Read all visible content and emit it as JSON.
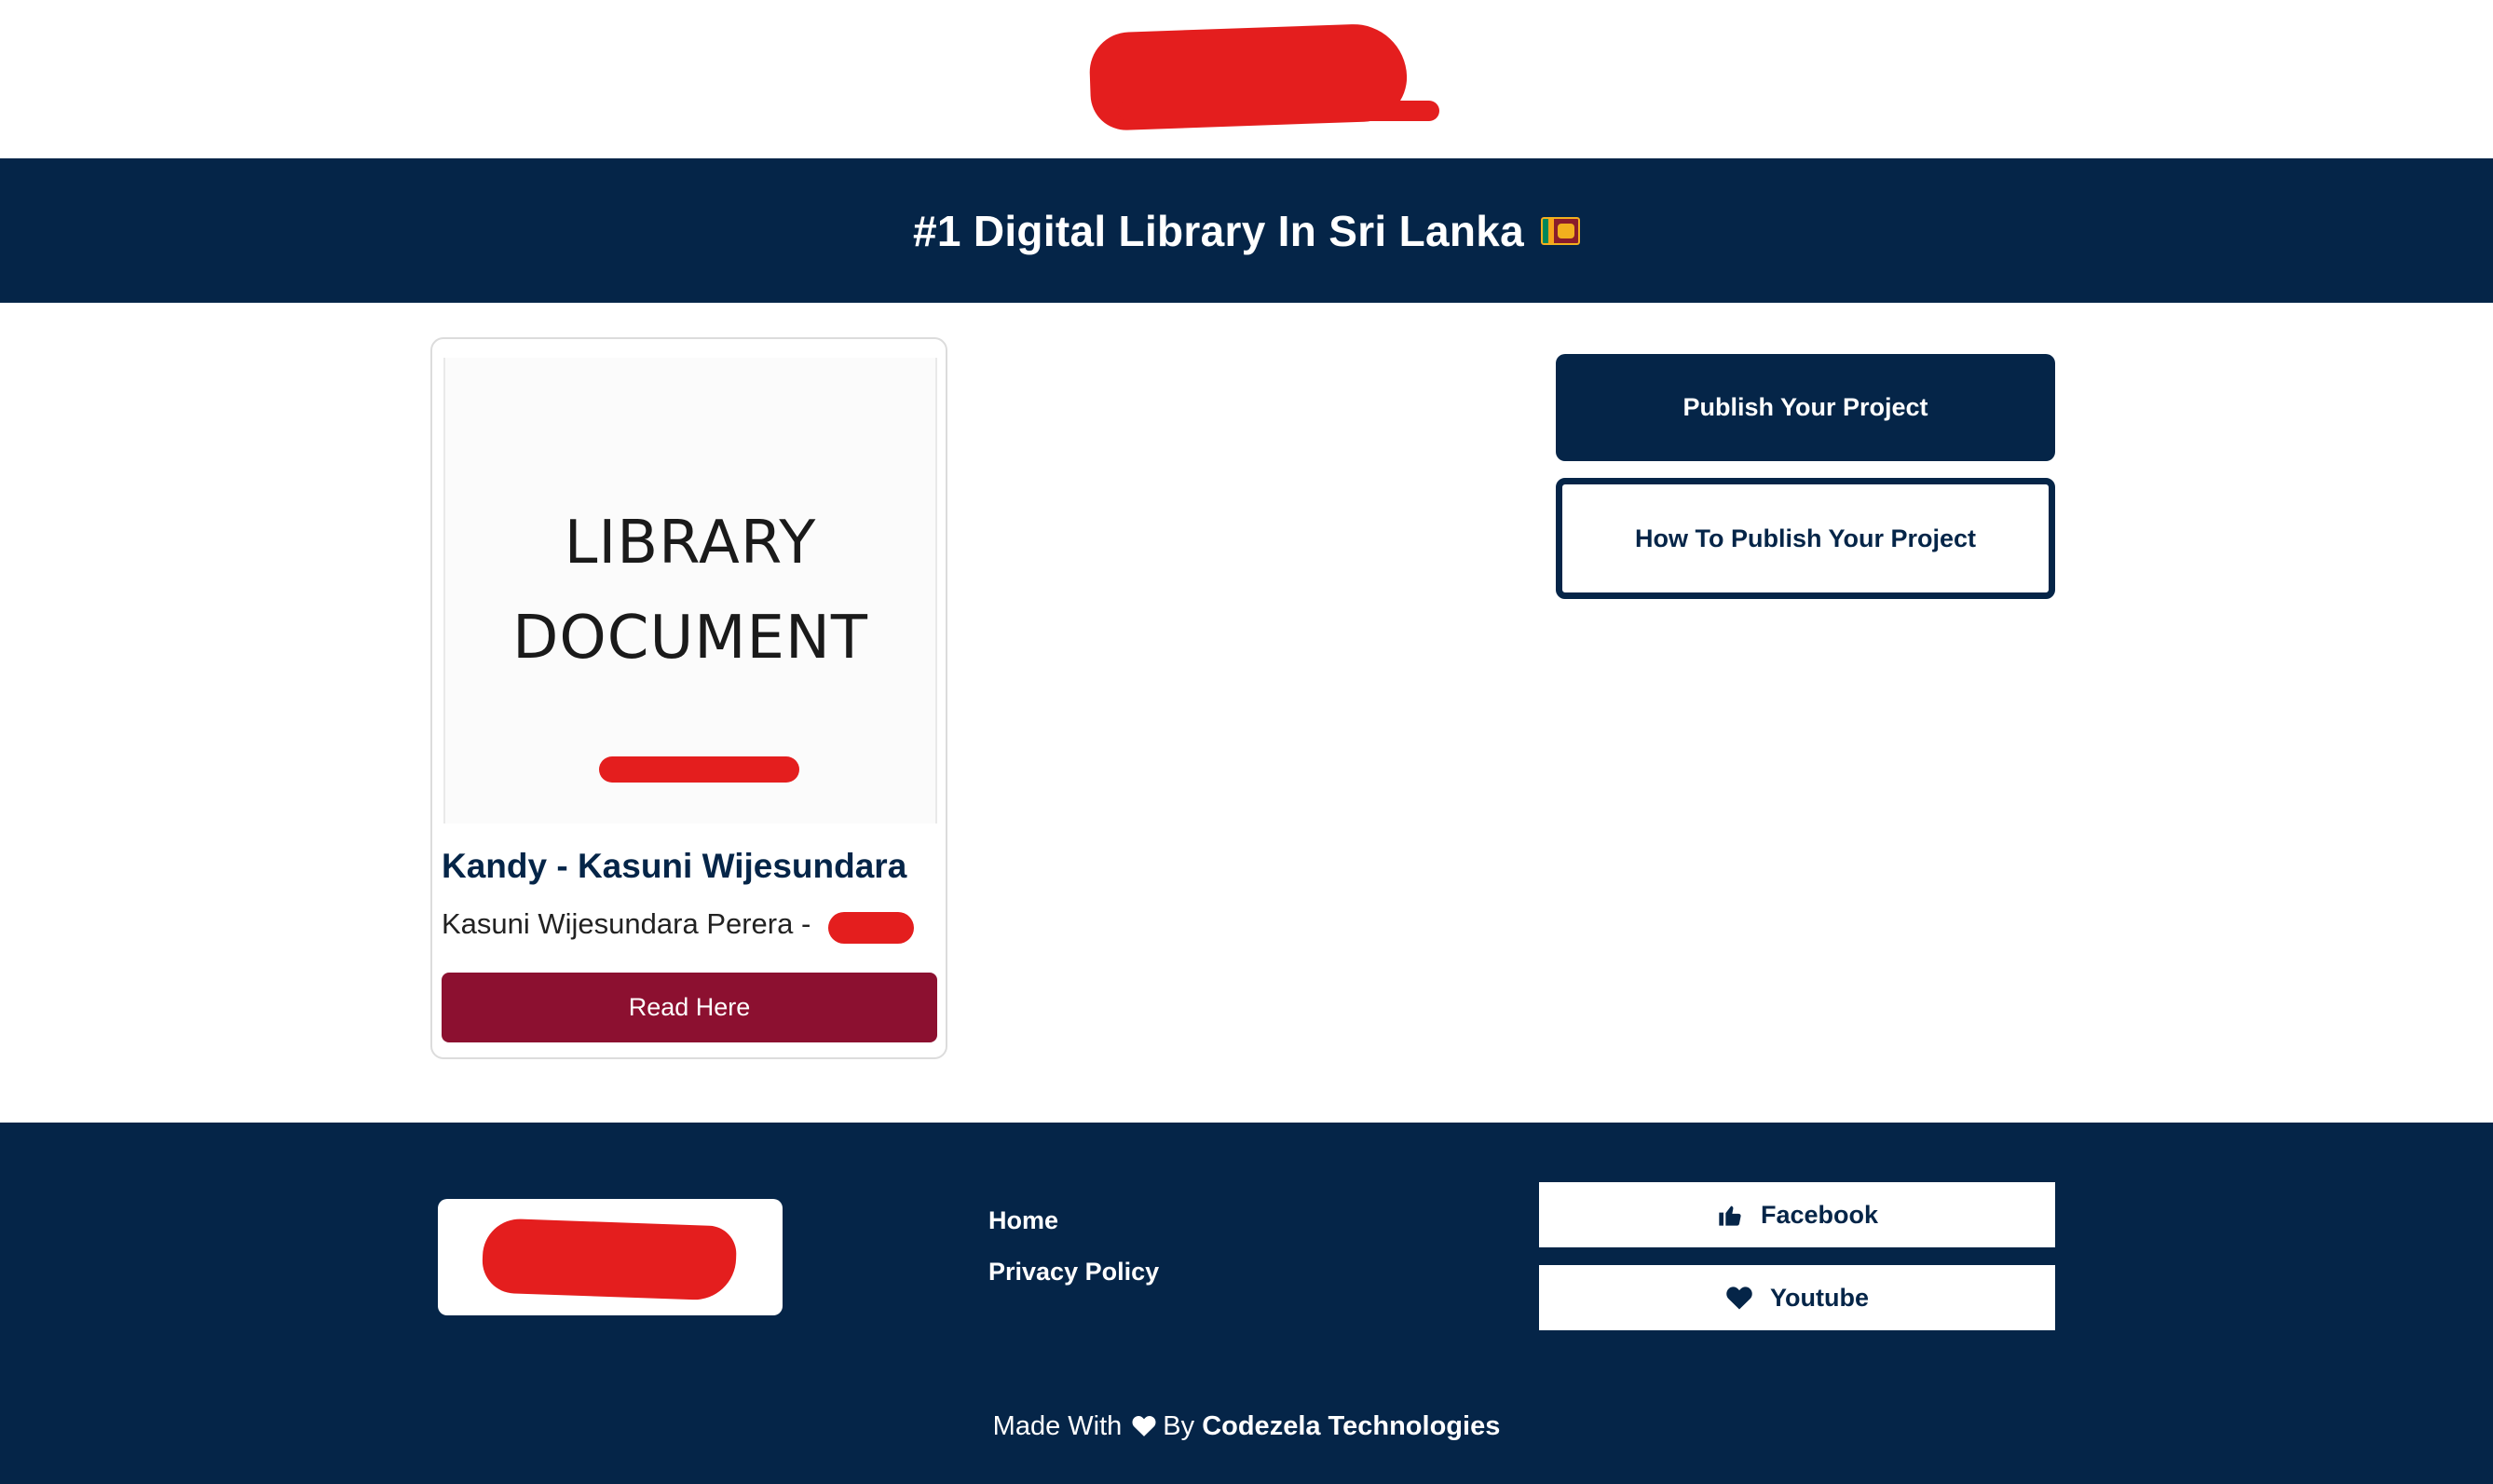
{
  "banner": {
    "title": "#1 Digital Library In Sri Lanka",
    "flag_icon": "sri-lanka-flag-icon"
  },
  "card": {
    "thumbnail_lines": [
      "LIBRARY",
      "DOCUMENT"
    ],
    "title": "Kandy - Kasuni Wijesundara",
    "author": "Kasuni Wijesundara Perera  -",
    "read_label": "Read Here"
  },
  "actions": {
    "publish_label": "Publish Your Project",
    "howto_label": "How To Publish Your Project"
  },
  "footer": {
    "links": [
      "Home",
      "Privacy Policy"
    ],
    "social": [
      {
        "label": "Facebook",
        "icon": "thumbs-up-icon"
      },
      {
        "label": "Youtube",
        "icon": "heart-icon"
      }
    ],
    "credit_prefix": "Made With",
    "credit_by": "By",
    "credit_company": "Codezela Technologies"
  },
  "colors": {
    "navy": "#052548",
    "read_button": "#8c1030",
    "redaction": "#e41e1e"
  }
}
